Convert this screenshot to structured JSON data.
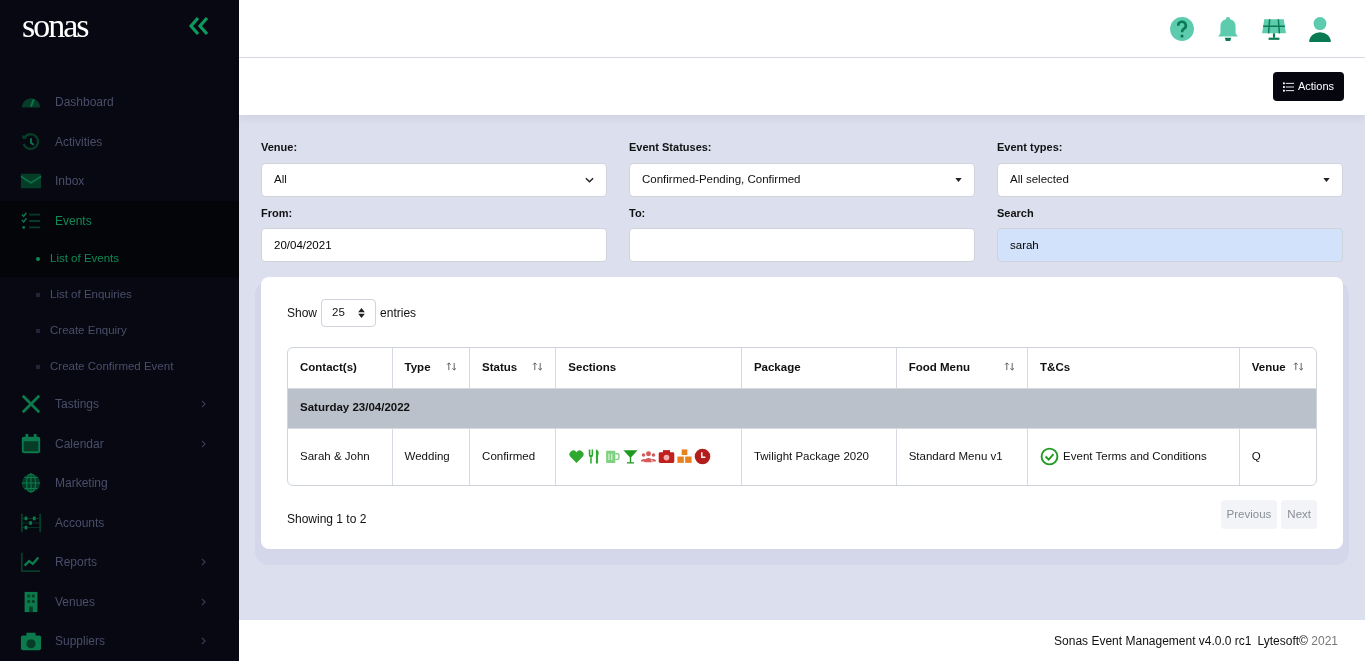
{
  "brand": {
    "logo": "sonas"
  },
  "sidebar": {
    "items": [
      {
        "label": "Dashboard",
        "selected": false,
        "has_submenu": false
      },
      {
        "label": "Activities",
        "selected": false,
        "has_submenu": false
      },
      {
        "label": "Inbox",
        "selected": false,
        "has_submenu": false
      },
      {
        "label": "Events",
        "selected": true,
        "has_submenu": false,
        "expanded": true,
        "children": [
          {
            "label": "List of Events",
            "selected": true
          },
          {
            "label": "List of Enquiries",
            "selected": false
          },
          {
            "label": "Create Enquiry",
            "selected": false
          },
          {
            "label": "Create Confirmed Event",
            "selected": false
          }
        ]
      },
      {
        "label": "Tastings",
        "selected": false,
        "has_submenu": true
      },
      {
        "label": "Calendar",
        "selected": false,
        "has_submenu": true
      },
      {
        "label": "Marketing",
        "selected": false,
        "has_submenu": false
      },
      {
        "label": "Accounts",
        "selected": false,
        "has_submenu": false
      },
      {
        "label": "Reports",
        "selected": false,
        "has_submenu": true
      },
      {
        "label": "Venues",
        "selected": false,
        "has_submenu": true
      },
      {
        "label": "Suppliers",
        "selected": false,
        "has_submenu": true
      }
    ]
  },
  "toolbar": {
    "actions_button": "Actions"
  },
  "filters": [
    {
      "label": "Venue:",
      "kind": "select",
      "value": "All"
    },
    {
      "label": "Event Statuses:",
      "kind": "multiselect",
      "value": "Confirmed-Pending, Confirmed"
    },
    {
      "label": "Event types:",
      "kind": "multiselect",
      "value": "All selected"
    },
    {
      "label": "From:",
      "kind": "text",
      "value": "20/04/2021"
    },
    {
      "label": "To:",
      "kind": "text"
    },
    {
      "label": "Search",
      "kind": "search",
      "value": "sarah"
    }
  ],
  "table": {
    "show_label": "Show",
    "page_size": "25",
    "entries_label": "entries",
    "columns": [
      {
        "label": "Contact(s)",
        "sortable": false
      },
      {
        "label": "Type",
        "sortable": true
      },
      {
        "label": "Status",
        "sortable": true
      },
      {
        "label": "Sections",
        "sortable": false
      },
      {
        "label": "Package",
        "sortable": false
      },
      {
        "label": "Food Menu",
        "sortable": true
      },
      {
        "label": "T&Cs",
        "sortable": false
      },
      {
        "label": "Venue",
        "sortable": true
      }
    ],
    "groups": [
      {
        "heading": "Saturday 23/04/2022",
        "rows": [
          {
            "contact": "Sarah & John",
            "type": "Wedding",
            "status": "Confirmed",
            "sections": [
              {
                "kind": "heart",
                "color": "#2ea82e"
              },
              {
                "kind": "cutlery",
                "color": "#2ea82e"
              },
              {
                "kind": "mug",
                "color": "#7fd07f"
              },
              {
                "kind": "cocktail",
                "color": "#1e9a1e"
              },
              {
                "kind": "people",
                "color": "#d65a5a"
              },
              {
                "kind": "camera",
                "color": "#c0201e"
              },
              {
                "kind": "boxes",
                "color": "#e8821e"
              },
              {
                "kind": "clock",
                "color": "#b51c1c"
              }
            ],
            "package": "Twilight Package 2020",
            "food_menu": "Standard Menu v1",
            "terms": "Event Terms and Conditions",
            "terms_accepted": true,
            "venue": "Q"
          }
        ]
      }
    ],
    "info": "Showing 1 to 2",
    "pagination": [
      {
        "label": "Previous",
        "disabled": true
      },
      {
        "label": "Next",
        "disabled": true
      }
    ]
  },
  "footer": {
    "product": "Sonas Event Management v4.0.0 rc1",
    "company": "Lytesoft©",
    "year": "2021"
  }
}
